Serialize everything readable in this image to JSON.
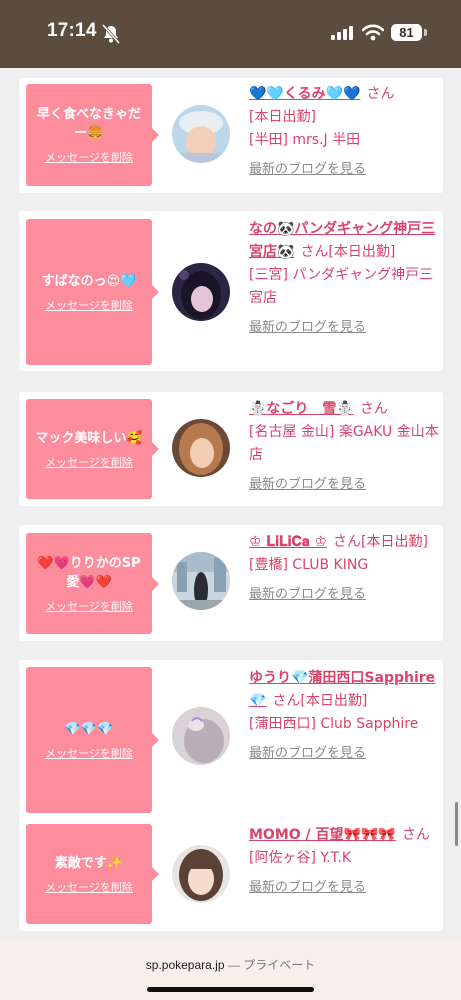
{
  "status": {
    "time": "17:14",
    "battery": "81"
  },
  "cards": [
    {
      "message": "早く食べなきゃだー🍔",
      "delete_label": "メッセージを削除",
      "name": "💙🩵くるみ🩵💙",
      "san": "さん",
      "shift": "[本日出勤]",
      "shop": "[半田] mrs.J 半田",
      "blog_label": "最新のブログを見る"
    },
    {
      "message": "すばなのっ😍🩵",
      "delete_label": "メッセージを削除",
      "name": "なの🐼パンダギャング神戸三宮店🐼",
      "san": "さん[本日出勤]",
      "shop": "[三宮] パンダギャング神戸三宮店",
      "blog_label": "最新のブログを見る"
    },
    {
      "message": "マック美味しい🥰",
      "delete_label": "メッセージを削除",
      "name": "☃️なごり　雪☃️",
      "san": "さん",
      "shop": "[名古屋 金山] 楽GAKU 金山本店",
      "blog_label": "最新のブログを見る"
    },
    {
      "message": "❤️💗りりかのSP愛💗❤️",
      "delete_label": "メッセージを削除",
      "name": "♔ 𝐋𝐢𝐋𝐢𝐂𝐚 ♔",
      "san": "さん[本日出勤]",
      "shop": "[豊橋] CLUB KING",
      "blog_label": "最新のブログを見る"
    },
    {
      "message": "💎💎💎",
      "delete_label": "メッセージを削除",
      "name": "ゆうり💎蒲田西口Sapphire💎",
      "san": "さん[本日出勤]",
      "shop": "[蒲田西口] Club Sapphire",
      "blog_label": "最新のブログを見る"
    },
    {
      "message": "素敵です✨",
      "delete_label": "メッセージを削除",
      "name": "MOMO / 百望🎀🎀🎀",
      "san": "さん",
      "shop": "[阿佐ヶ谷] Y.T.K",
      "blog_label": "最新のブログを見る"
    }
  ],
  "browser": {
    "domain": "sp.pokepara.jp",
    "mode": "— プライベート"
  },
  "colors": {
    "accent_pink": "#fd8c9d",
    "name_pink": "#d9436a",
    "status_bar": "#5c4c3d"
  }
}
